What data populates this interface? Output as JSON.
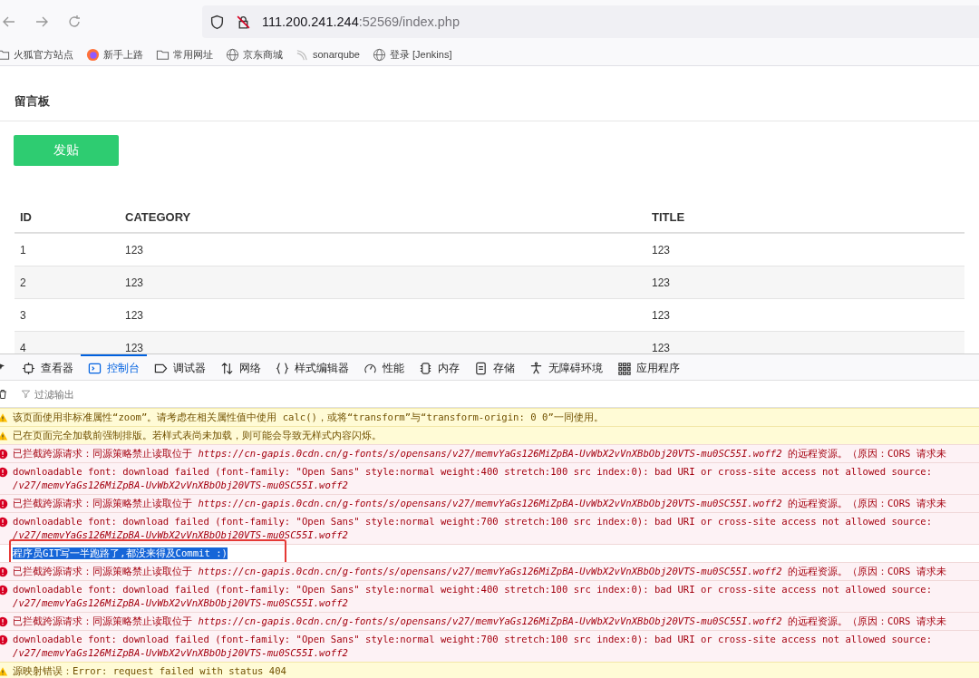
{
  "browser": {
    "url_host": "111.200.241.244",
    "url_path": ":52569/index.php"
  },
  "bookmarks": [
    {
      "kind": "folder",
      "label": "火狐官方站点"
    },
    {
      "kind": "firefox",
      "label": "新手上路"
    },
    {
      "kind": "folder",
      "label": "常用网址"
    },
    {
      "kind": "globe",
      "label": "京东商城"
    },
    {
      "kind": "wave",
      "label": "sonarqube"
    },
    {
      "kind": "globe",
      "label": "登录 [Jenkins]"
    }
  ],
  "page": {
    "title": "留言板",
    "post_button": "发贴",
    "table": {
      "columns": [
        "ID",
        "CATEGORY",
        "TITLE"
      ],
      "rows": [
        [
          "1",
          "123",
          "123"
        ],
        [
          "2",
          "123",
          "123"
        ],
        [
          "3",
          "123",
          "123"
        ],
        [
          "4",
          "123",
          "123"
        ]
      ]
    }
  },
  "devtools": {
    "tabs": [
      {
        "kind": "inspector",
        "label": "查看器",
        "selected": false
      },
      {
        "kind": "console",
        "label": "控制台",
        "selected": true
      },
      {
        "kind": "debugger",
        "label": "调试器",
        "selected": false
      },
      {
        "kind": "network",
        "label": "网络",
        "selected": false
      },
      {
        "kind": "style",
        "label": "样式编辑器",
        "selected": false
      },
      {
        "kind": "performance",
        "label": "性能",
        "selected": false
      },
      {
        "kind": "memory",
        "label": "内存",
        "selected": false
      },
      {
        "kind": "storage",
        "label": "存储",
        "selected": false
      },
      {
        "kind": "accessibility",
        "label": "无障碍环境",
        "selected": false
      },
      {
        "kind": "application",
        "label": "应用程序",
        "selected": false
      }
    ],
    "filter_placeholder": "过滤输出",
    "messages": [
      {
        "kind": "warning",
        "text": "该页面使用非标准属性“zoom”。请考虑在相关属性值中使用 calc()，或将“transform”与“transform-origin: 0 0”一同使用。"
      },
      {
        "kind": "warning",
        "text": "已在页面完全加载前强制排版。若样式表尚未加载，则可能会导致无样式内容闪烁。"
      },
      {
        "kind": "error",
        "text": "已拦截跨源请求：同源策略禁止读取位于 *https://cn-gapis.0cdn.cn/g-fonts/s/opensans/v27/memvYaGs126MiZpBA-UvWbX2vVnXBbObj20VTS-mu0SC55I.woff2* 的远程资源。（原因：CORS 请求未"
      },
      {
        "kind": "error",
        "text": "downloadable font: download failed (font-family: \"Open Sans\" style:normal weight:400 stretch:100 src index:0): bad URI or cross-site access not allowed source:",
        "detail": "/v27/memvYaGs126MiZpBA-UvWbX2vVnXBbObj20VTS-mu0SC55I.woff2"
      },
      {
        "kind": "error",
        "text": "已拦截跨源请求：同源策略禁止读取位于 *https://cn-gapis.0cdn.cn/g-fonts/s/opensans/v27/memvYaGs126MiZpBA-UvWbX2vVnXBbObj20VTS-mu0SC55I.woff2* 的远程资源。（原因：CORS 请求未"
      },
      {
        "kind": "error",
        "text": "downloadable font: download failed (font-family: \"Open Sans\" style:normal weight:700 stretch:100 src index:0): bad URI or cross-site access not allowed source:",
        "detail": "/v27/memvYaGs126MiZpBA-UvWbX2vVnXBbObj20VTS-mu0SC55I.woff2"
      },
      {
        "kind": "log",
        "text": "程序员GIT写一半跑路了,都没来得及Commit :)",
        "selected": true
      },
      {
        "kind": "error",
        "text": "已拦截跨源请求：同源策略禁止读取位于 *https://cn-gapis.0cdn.cn/g-fonts/s/opensans/v27/memvYaGs126MiZpBA-UvWbX2vVnXBbObj20VTS-mu0SC55I.woff2* 的远程资源。（原因：CORS 请求未"
      },
      {
        "kind": "error",
        "text": "downloadable font: download failed (font-family: \"Open Sans\" style:normal weight:400 stretch:100 src index:0): bad URI or cross-site access not allowed source:",
        "detail": "/v27/memvYaGs126MiZpBA-UvWbX2vVnXBbObj20VTS-mu0SC55I.woff2"
      },
      {
        "kind": "error",
        "text": "已拦截跨源请求：同源策略禁止读取位于 *https://cn-gapis.0cdn.cn/g-fonts/s/opensans/v27/memvYaGs126MiZpBA-UvWbX2vVnXBbObj20VTS-mu0SC55I.woff2* 的远程资源。（原因：CORS 请求未"
      },
      {
        "kind": "error",
        "text": "downloadable font: download failed (font-family: \"Open Sans\" style:normal weight:700 stretch:100 src index:0): bad URI or cross-site access not allowed source:",
        "detail": "/v27/memvYaGs126MiZpBA-UvWbX2vVnXBbObj20VTS-mu0SC55I.woff2"
      },
      {
        "kind": "warning",
        "text": "源映射错误：Error: request failed with status 404"
      }
    ]
  }
}
